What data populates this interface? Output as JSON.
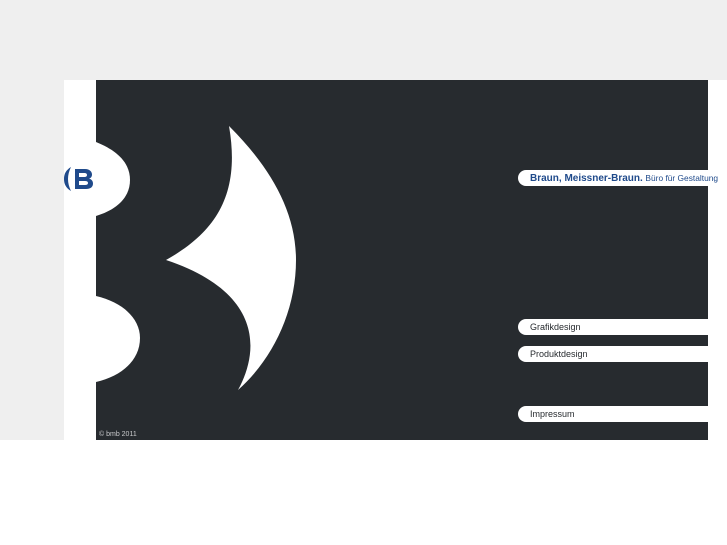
{
  "brand": {
    "name": "Braun, Meissner-Braun.",
    "tagline": "Büro für Gestaltung"
  },
  "nav": {
    "items": [
      {
        "label": "Grafikdesign"
      },
      {
        "label": "Produktdesign"
      },
      {
        "label": "Impressum"
      }
    ]
  },
  "footer": {
    "copyright": "© bmb 2011"
  },
  "colors": {
    "background": "#efefef",
    "panel": "#272b2f",
    "brand_blue": "#1f4a8b",
    "white": "#ffffff"
  },
  "logo": {
    "icon": "bmb-logo-icon"
  }
}
